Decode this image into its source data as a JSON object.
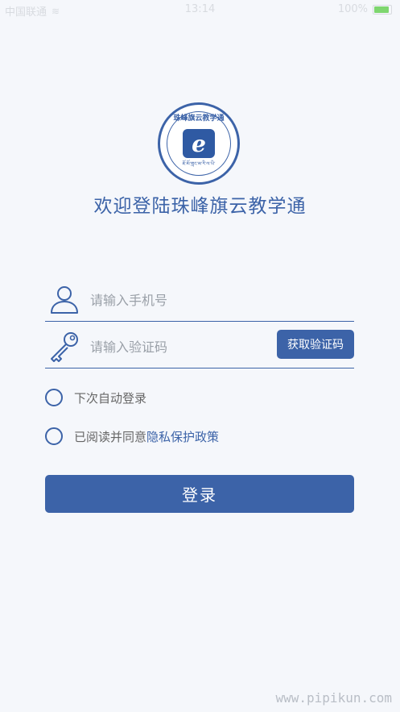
{
  "status_bar": {
    "carrier": "中国联通",
    "time": "13:14",
    "battery": "100%"
  },
  "logo": {
    "top_text": "珠峰旗云教学通",
    "emblem_letter": "e",
    "bottom_text": "ཇོ་མོ་གླང་མ་རི་ལ་ཡི་"
  },
  "welcome_text": "欢迎登陆珠峰旗云教学通",
  "phone": {
    "placeholder": "请输入手机号",
    "value": ""
  },
  "code": {
    "placeholder": "请输入验证码",
    "value": "",
    "get_code_label": "获取验证码"
  },
  "auto_login": {
    "label": "下次自动登录"
  },
  "privacy": {
    "prefix": "已阅读并同意",
    "link": "隐私保护政策"
  },
  "login_button": "登录",
  "watermark": "www.pipikun.com",
  "colors": {
    "primary": "#3c63a8",
    "background": "#f5f7fb",
    "placeholder": "#9aa0a8"
  }
}
